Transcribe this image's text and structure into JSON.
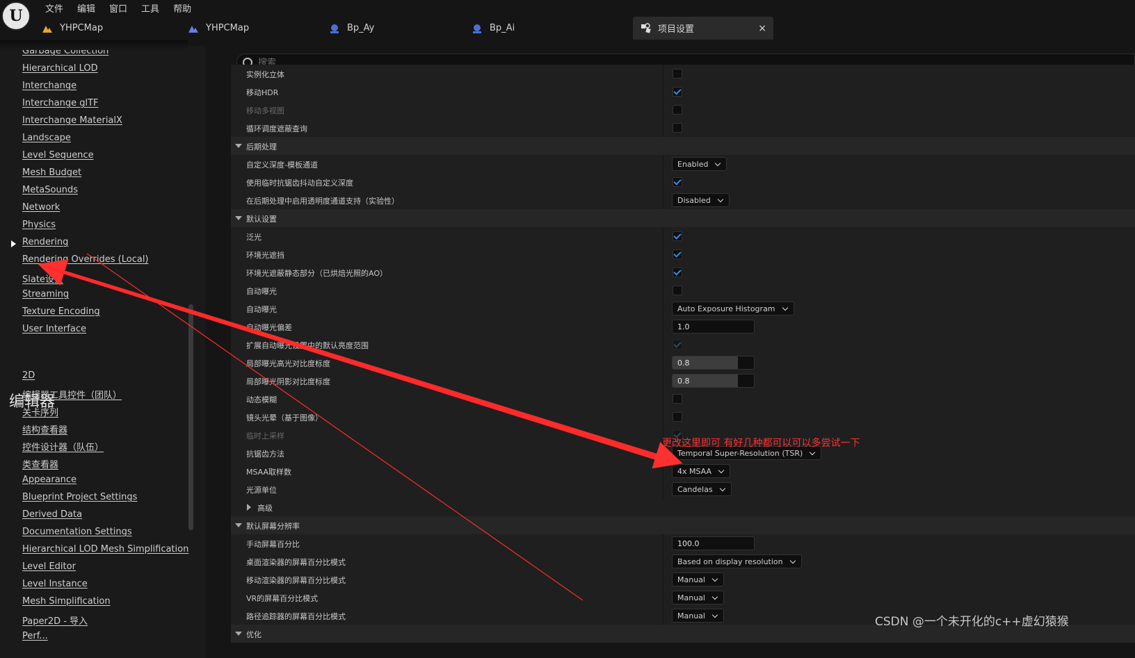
{
  "menubar": [
    "文件",
    "编辑",
    "窗口",
    "工具",
    "帮助"
  ],
  "tabs": [
    {
      "label": "YHPCMap",
      "icon": "level-map-icon",
      "color": "#e8a33a"
    },
    {
      "label": "YHPCMap",
      "icon": "level-map-icon",
      "color": "#6a7de8"
    },
    {
      "label": "Bp_Ay",
      "icon": "blueprint-icon",
      "color": "#4a6fd8"
    },
    {
      "label": "Bp_Ai",
      "icon": "blueprint-icon",
      "color": "#4a6fd8"
    },
    {
      "label": "项目设置",
      "icon": "settings-icon",
      "active": true,
      "close": "×"
    }
  ],
  "search": {
    "placeholder": "搜索"
  },
  "sidebar": {
    "items_top": [
      "Garbage Collection",
      "Hierarchical LOD",
      "Interchange",
      "Interchange glTF",
      "Interchange MaterialX",
      "Landscape",
      "Level Sequence",
      "Mesh Budget",
      "MetaSounds",
      "Network",
      "Physics",
      "Rendering",
      "Rendering Overrides (Local)",
      "Slate设置",
      "Streaming",
      "Texture Encoding",
      "User Interface"
    ],
    "selected": "Rendering",
    "section_editor": "编辑器",
    "items_editor": [
      "2D",
      "编辑器工具控件（团队）",
      "关卡序列",
      "结构查看器",
      "控件设计器（队伍）",
      "类查看器",
      "Appearance",
      "Blueprint Project Settings",
      "Derived Data",
      "Documentation Settings",
      "Hierarchical LOD Mesh Simplification",
      "Level Editor",
      "Level Instance",
      "Mesh Simplification",
      "Paper2D - 导入",
      "Perf..."
    ]
  },
  "settings": [
    {
      "label": "实例化立体",
      "type": "checkbox",
      "checked": false
    },
    {
      "label": "移动HDR",
      "type": "checkbox",
      "checked": true
    },
    {
      "label": "移动多视图",
      "type": "checkbox",
      "checked": false,
      "disabled": true
    },
    {
      "label": "循环调度遮蔽查询",
      "type": "checkbox",
      "checked": false
    },
    {
      "label": "后期处理",
      "type": "section"
    },
    {
      "label": "自定义深度-模板通道",
      "type": "dropdown",
      "value": "Enabled"
    },
    {
      "label": "使用临时抗锯齿抖动自定义深度",
      "type": "checkbox",
      "checked": true
    },
    {
      "label": "在后期处理中启用透明度通道支持（实验性）",
      "type": "dropdown",
      "value": "Disabled"
    },
    {
      "label": "默认设置",
      "type": "section"
    },
    {
      "label": "泛光",
      "type": "checkbox",
      "checked": true
    },
    {
      "label": "环境光遮挡",
      "type": "checkbox",
      "checked": true
    },
    {
      "label": "环境光遮蔽静态部分（已烘焙光照的AO）",
      "type": "checkbox",
      "checked": true
    },
    {
      "label": "自动曝光",
      "type": "checkbox",
      "checked": false
    },
    {
      "label": "自动曝光",
      "type": "dropdown",
      "value": "Auto Exposure Histogram"
    },
    {
      "label": "自动曝光偏差",
      "type": "number",
      "value": "1.0"
    },
    {
      "label": "扩展自动曝光设置中的默认亮度范围",
      "type": "checkbox",
      "checked": true,
      "dim": true
    },
    {
      "label": "局部曝光高光对比度标度",
      "type": "slider",
      "value": "0.8",
      "fraction": 0.8
    },
    {
      "label": "局部曝光阴影对比度标度",
      "type": "slider",
      "value": "0.8",
      "fraction": 0.8
    },
    {
      "label": "动态模糊",
      "type": "checkbox",
      "checked": false
    },
    {
      "label": "镜头光晕（基于图像）",
      "type": "checkbox",
      "checked": false
    },
    {
      "label": "临时上采样",
      "type": "checkbox",
      "checked": true,
      "disabled": true,
      "dim": true
    },
    {
      "label": "抗锯齿方法",
      "type": "dropdown",
      "value": "Temporal Super-Resolution (TSR)"
    },
    {
      "label": "MSAA取样数",
      "type": "dropdown",
      "value": "4x MSAA"
    },
    {
      "label": "光源单位",
      "type": "dropdown",
      "value": "Candelas"
    },
    {
      "label": "高级",
      "type": "subsection"
    },
    {
      "label": "默认屏幕分辨率",
      "type": "section"
    },
    {
      "label": "手动屏幕百分比",
      "type": "number",
      "value": "100.0"
    },
    {
      "label": "桌面渲染器的屏幕百分比模式",
      "type": "dropdown",
      "value": "Based on display resolution"
    },
    {
      "label": "移动渲染器的屏幕百分比模式",
      "type": "dropdown",
      "value": "Manual"
    },
    {
      "label": "VR的屏幕百分比模式",
      "type": "dropdown",
      "value": "Manual"
    },
    {
      "label": "路径追踪器的屏幕百分比模式",
      "type": "dropdown",
      "value": "Manual"
    },
    {
      "label": "优化",
      "type": "section"
    }
  ],
  "annotation": {
    "text": "更改这里即可 有好几种都可以可以多尝试一下",
    "color": "#ff3030"
  },
  "watermark": "CSDN @一个未开化的c++虚幻猿猴",
  "colors": {
    "accent_check": "#2f8ee5",
    "annotation_red": "#ff3030",
    "background": "#151515"
  }
}
